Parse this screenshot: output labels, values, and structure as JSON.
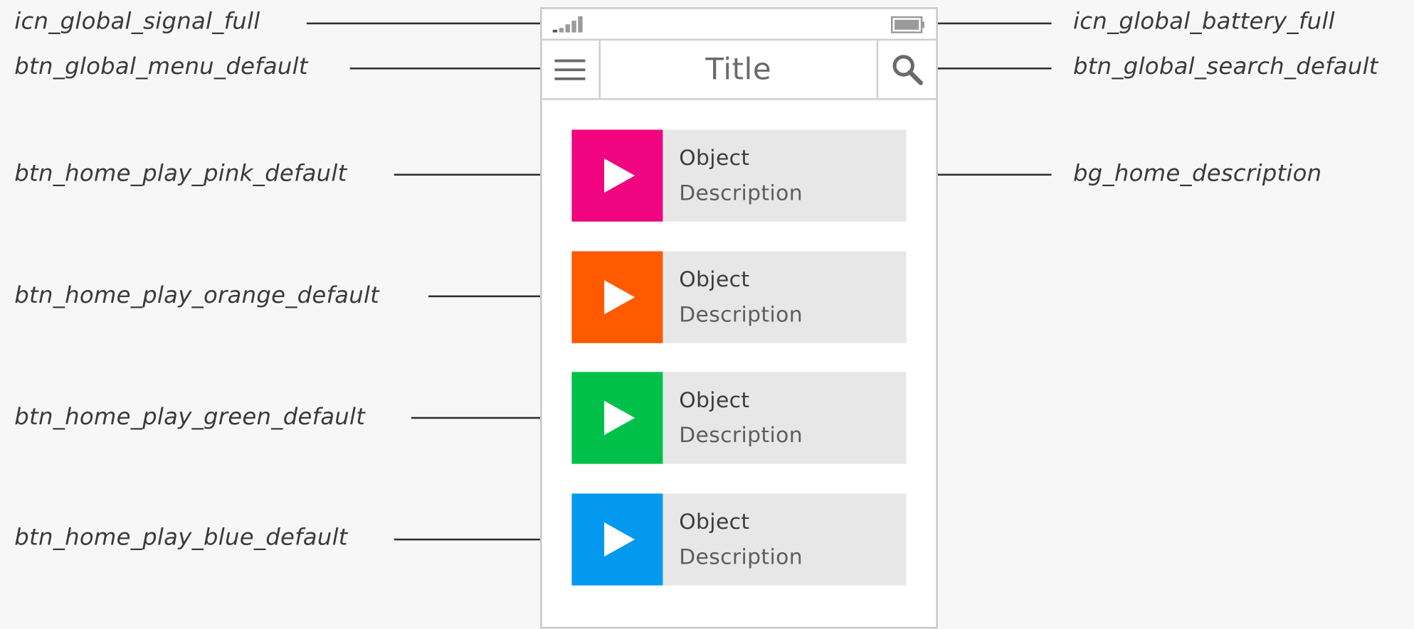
{
  "labels": {
    "signal": "icn_global_signal_full",
    "battery": "icn_global_battery_full",
    "menu": "btn_global_menu_default",
    "search": "btn_global_search_default",
    "play_pink": "btn_home_play_pink_default",
    "description_bg": "bg_home_description",
    "play_orange": "btn_home_play_orange_default",
    "play_green": "btn_home_play_green_default",
    "play_blue": "btn_home_play_blue_default"
  },
  "app_bar": {
    "title": "Title"
  },
  "icons": {
    "signal": "signal-full-icon",
    "battery": "battery-full-icon",
    "menu": "hamburger-menu-icon",
    "search": "magnifier-search-icon",
    "play": "play-triangle-icon"
  },
  "items": [
    {
      "title": "Object",
      "description": "Description",
      "color": "#f0047f"
    },
    {
      "title": "Object",
      "description": "Description",
      "color": "#ff5a00"
    },
    {
      "title": "Object",
      "description": "Description",
      "color": "#00c04a"
    },
    {
      "title": "Object",
      "description": "Description",
      "color": "#0399ee"
    }
  ],
  "colors": {
    "background": "#f7f7f7",
    "card_background": "#e7e7e7",
    "frame": "#c9c9c9"
  }
}
